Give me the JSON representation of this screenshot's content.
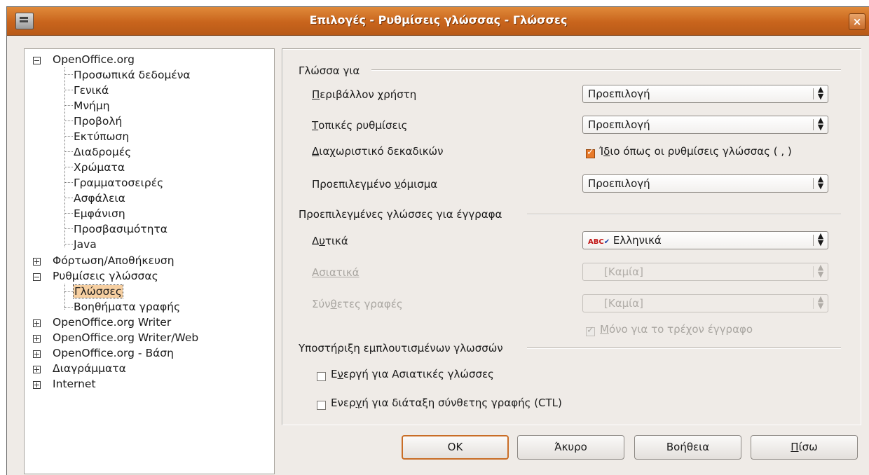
{
  "window": {
    "title": "Επιλογές - Ρυθμίσεις γλώσσας - Γλώσσες",
    "close_label": "×"
  },
  "tree": {
    "openoffice": "OpenOffice.org",
    "children": [
      "Προσωπικά δεδομένα",
      "Γενικά",
      "Μνήμη",
      "Προβολή",
      "Εκτύπωση",
      "Διαδρομές",
      "Χρώματα",
      "Γραμματοσειρές",
      "Ασφάλεια",
      "Εμφάνιση",
      "Προσβασιμότητα",
      "Java"
    ],
    "load_save": "Φόρτωση/Αποθήκευση",
    "language_settings": "Ρυθμίσεις γλώσσας",
    "languages": "Γλώσσες",
    "writing_aids": "Βοηθήματα γραφής",
    "writer": "OpenOffice.org Writer",
    "writer_web": "OpenOffice.org Writer/Web",
    "base": "OpenOffice.org - Βάση",
    "charts": "Διαγράμματα",
    "internet": "Internet"
  },
  "language_of": {
    "title": "Γλώσσα για",
    "ui_label_pre": "",
    "ui_label_mn": "Π",
    "ui_label_post": "εριβάλλον χρήστη",
    "ui_value": "Προεπιλογή",
    "locale_label_pre": "",
    "locale_label_mn": "Τ",
    "locale_label_post": "οπικές ρυθμίσεις",
    "locale_value": "Προεπιλογή",
    "decimal_label_pre": "",
    "decimal_label_mn": "Δ",
    "decimal_label_post": "ιαχωριστικό δεκαδικών",
    "decimal_check_pre": "Ί",
    "decimal_check_mn": "δ",
    "decimal_check_post": "ιο όπως οι ρυθμίσεις γλώσσας ( , )",
    "decimal_checked": true,
    "currency_label_pre": "Προεπιλεγμένο ",
    "currency_label_mn": "ν",
    "currency_label_post": "όμισμα",
    "currency_value": "Προεπιλογή"
  },
  "default_languages": {
    "title": "Προεπιλεγμένες γλώσσες για έγγραφα",
    "western_label_pre": "Δ",
    "western_label_mn": "υ",
    "western_label_post": "τικά",
    "western_value": "Ελληνικά",
    "western_icon": "ABC",
    "asian_label": "Ασιατικά",
    "asian_value": "[Καμία]",
    "ctl_label_pre": "Σύν",
    "ctl_label_mn": "θ",
    "ctl_label_post": "ετες γραφές",
    "ctl_value": "[Καμία]",
    "current_doc_mn": "Μ",
    "current_doc_post": "όνο για το τρέχον έγγραφο",
    "current_doc_checked": true
  },
  "enhanced": {
    "title": "Υποστήριξη εμπλουτισμένων γλωσσών",
    "asian_pre": "Ε",
    "asian_mn": "ν",
    "asian_post": "εργή για Ασιατικές γλώσσες",
    "asian_checked": false,
    "ctl_pre": "Ενερ",
    "ctl_mn": "γ",
    "ctl_post": "ή για διάταξη σύνθετης γραφής (CTL)",
    "ctl_checked": false
  },
  "buttons": {
    "ok": "OK",
    "cancel": "Άκυρο",
    "help": "Βοήθεια",
    "back_mn": "Π",
    "back_post": "ίσω"
  }
}
